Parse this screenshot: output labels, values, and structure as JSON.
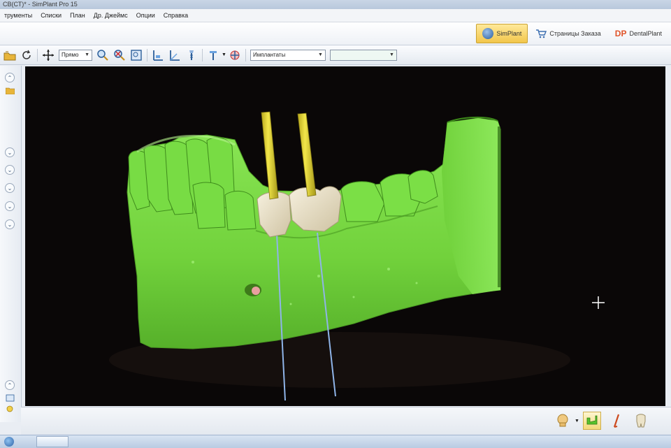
{
  "window": {
    "title": "СВ(СТ)* - SimPlant Pro 15"
  },
  "menu": {
    "items": [
      "трументы",
      "Списки",
      "План",
      "Др. Джеймс",
      "Опции",
      "Справка"
    ]
  },
  "app_tabs": [
    {
      "label": "SimPlant",
      "icon": "simplant-logo-icon",
      "active": true
    },
    {
      "label": "Страницы Заказа",
      "icon": "cart-icon",
      "active": false
    },
    {
      "label": "DentalPlant",
      "icon": "dp-logo-icon",
      "active": false
    }
  ],
  "toolbar": {
    "view_select": "Прямо",
    "object_select": "Имплантаты",
    "empty_select": "",
    "icons": [
      "open-folder-icon",
      "rotate-icon",
      "pan-icon",
      "zoom-icon",
      "zoom-reset-icon",
      "fit-view-icon",
      "measure-distance-icon",
      "measure-angle-icon",
      "implant-icon",
      "nerve-tracing-icon",
      "drill-icon"
    ]
  },
  "left_panel": {
    "buttons": [
      "collapse-up-icon",
      "expand-icon",
      "expand-icon",
      "expand-icon",
      "expand-icon",
      "expand-icon",
      "collapse-bottom-icon"
    ]
  },
  "viewport": {
    "background": "#0a0707",
    "jaw_color": "#7ee04a",
    "implant_color": "#e6d931",
    "crown_color": "#e7dfc9",
    "axis_color": "#8fb4e8",
    "cursor_icon": "crosshair-cursor-icon"
  },
  "bottom_tools": [
    "skull-view-icon",
    "jaw-view-icon",
    "nerve-view-icon",
    "tooth-view-icon"
  ],
  "colors": {
    "accent": "#f2c64b",
    "chrome": "#e9edf3"
  }
}
